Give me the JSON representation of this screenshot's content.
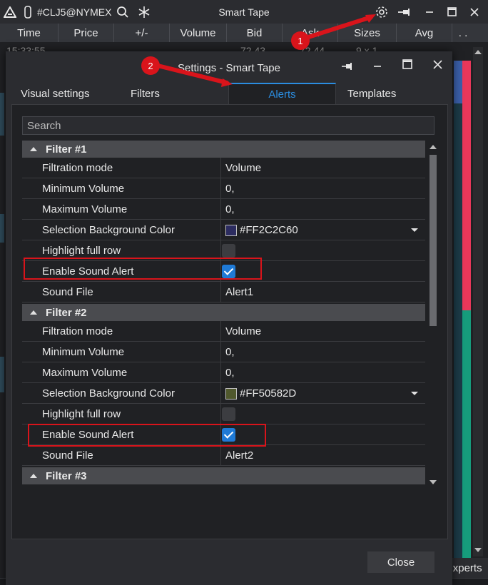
{
  "main_window": {
    "symbol": "#CLJ5@NYMEX",
    "title": "Smart Tape",
    "columns": [
      "Time",
      "Price",
      "+/-",
      "Volume",
      "Bid",
      "Ask",
      "Sizes",
      "Avg"
    ],
    "columns_more": ". .",
    "first_row": {
      "time": "15:33:55",
      "bid": "72.43",
      "ask": "72.44",
      "sizes": "9 x 1"
    },
    "experts_tab": "experts",
    "bar_colors": {
      "sell": "#e8375a",
      "buy": "#169c7c",
      "accent": "#3a5fa8"
    }
  },
  "dialog": {
    "title": "Settings - Smart Tape",
    "tabs": [
      {
        "label": "Visual settings",
        "active": false
      },
      {
        "label": "Filters",
        "active": false
      },
      {
        "label": "Alerts",
        "active": true
      },
      {
        "label": "Templates",
        "active": false
      }
    ],
    "search_placeholder": "Search",
    "filters": [
      {
        "name": "Filter #1",
        "rows": {
          "filtration_mode": {
            "label": "Filtration mode",
            "value": "Volume"
          },
          "minimum_volume": {
            "label": "Minimum Volume",
            "value": "0,"
          },
          "maximum_volume": {
            "label": "Maximum Volume",
            "value": "0,"
          },
          "selection_bg_color": {
            "label": "Selection Background Color",
            "value": "#FF2C2C60",
            "swatch": "#2c2c60"
          },
          "highlight_full_row": {
            "label": "Highlight full row",
            "checked": false
          },
          "enable_sound_alert": {
            "label": "Enable Sound Alert",
            "checked": true
          },
          "sound_file": {
            "label": "Sound File",
            "value": "Alert1"
          }
        }
      },
      {
        "name": "Filter #2",
        "rows": {
          "filtration_mode": {
            "label": "Filtration mode",
            "value": "Volume"
          },
          "minimum_volume": {
            "label": "Minimum Volume",
            "value": "0,"
          },
          "maximum_volume": {
            "label": "Maximum Volume",
            "value": "0,"
          },
          "selection_bg_color": {
            "label": "Selection Background Color",
            "value": "#FF50582D",
            "swatch": "#50582d"
          },
          "highlight_full_row": {
            "label": "Highlight full row",
            "checked": false
          },
          "enable_sound_alert": {
            "label": "Enable Sound Alert",
            "checked": true
          },
          "sound_file": {
            "label": "Sound File",
            "value": "Alert2"
          }
        }
      },
      {
        "name": "Filter #3"
      }
    ],
    "close_label": "Close"
  },
  "annotations": {
    "callout_1": "1",
    "callout_2": "2",
    "color": "#d9141b"
  }
}
